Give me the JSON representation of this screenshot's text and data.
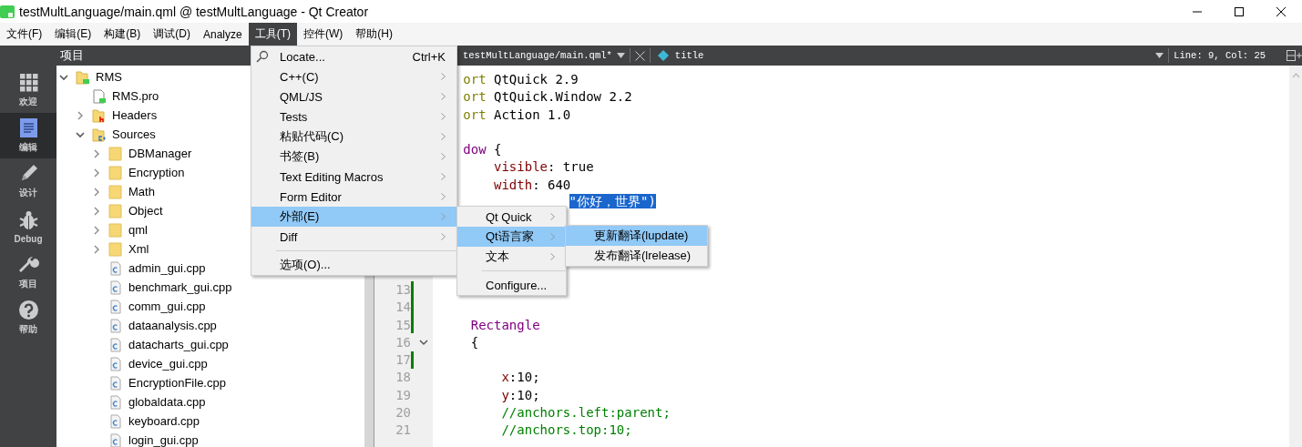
{
  "window": {
    "title": "testMultLanguage/main.qml @ testMultLanguage - Qt Creator"
  },
  "menubar": [
    {
      "label": "文件(F)",
      "selected": false
    },
    {
      "label": "编辑(E)",
      "selected": false
    },
    {
      "label": "构建(B)",
      "selected": false
    },
    {
      "label": "调试(D)",
      "selected": false
    },
    {
      "label": "Analyze",
      "selected": false
    },
    {
      "label": "工具(T)",
      "selected": true
    },
    {
      "label": "控件(W)",
      "selected": false
    },
    {
      "label": "帮助(H)",
      "selected": false
    }
  ],
  "mode_bar": [
    {
      "label": "欢迎",
      "kind": "welcome",
      "selected": false
    },
    {
      "label": "编辑",
      "kind": "edit",
      "selected": true
    },
    {
      "label": "设计",
      "kind": "design",
      "selected": false
    },
    {
      "label": "Debug",
      "kind": "debug",
      "selected": false
    },
    {
      "label": "项目",
      "kind": "projects",
      "selected": false
    },
    {
      "label": "帮助",
      "kind": "help",
      "selected": false
    }
  ],
  "project_panel": {
    "title": "项目",
    "tree": [
      {
        "label": "RMS",
        "kind": "project",
        "expanded": true,
        "children": [
          {
            "label": "RMS.pro",
            "kind": "pro-file"
          },
          {
            "label": "Headers",
            "kind": "header-folder",
            "expanded": false
          },
          {
            "label": "Sources",
            "kind": "source-folder",
            "expanded": true,
            "children": [
              {
                "label": "DBManager",
                "kind": "folder",
                "expanded": false
              },
              {
                "label": "Encryption",
                "kind": "folder",
                "expanded": false
              },
              {
                "label": "Math",
                "kind": "folder",
                "expanded": false
              },
              {
                "label": "Object",
                "kind": "folder",
                "expanded": false
              },
              {
                "label": "qml",
                "kind": "folder",
                "expanded": false
              },
              {
                "label": "Xml",
                "kind": "folder",
                "expanded": false
              },
              {
                "label": "admin_gui.cpp",
                "kind": "cpp-file"
              },
              {
                "label": "benchmark_gui.cpp",
                "kind": "cpp-file"
              },
              {
                "label": "comm_gui.cpp",
                "kind": "cpp-file"
              },
              {
                "label": "dataanalysis.cpp",
                "kind": "cpp-file"
              },
              {
                "label": "datacharts_gui.cpp",
                "kind": "cpp-file"
              },
              {
                "label": "device_gui.cpp",
                "kind": "cpp-file"
              },
              {
                "label": "EncryptionFile.cpp",
                "kind": "cpp-file"
              },
              {
                "label": "globaldata.cpp",
                "kind": "cpp-file"
              },
              {
                "label": "keyboard.cpp",
                "kind": "cpp-file"
              },
              {
                "label": "login_gui.cpp",
                "kind": "cpp-file"
              }
            ]
          }
        ]
      }
    ]
  },
  "editor": {
    "file": "testMultLanguage/main.qml*",
    "symbol": "title",
    "position": "Line: 9, Col: 25",
    "lines": [
      {
        "kind": "code",
        "tokens": [
          {
            "kind": "keyword",
            "text": "ort"
          },
          {
            "kind": "plain",
            "text": " QtQuick 2.9"
          }
        ]
      },
      {
        "kind": "code",
        "tokens": [
          {
            "kind": "keyword",
            "text": "ort"
          },
          {
            "kind": "plain",
            "text": " QtQuick.Window 2.2"
          }
        ]
      },
      {
        "kind": "code",
        "tokens": [
          {
            "kind": "keyword",
            "text": "ort"
          },
          {
            "kind": "plain",
            "text": " Action 1.0"
          }
        ]
      },
      {
        "kind": "blank"
      },
      {
        "kind": "code",
        "tokens": [
          {
            "kind": "type",
            "text": "dow"
          },
          {
            "kind": "plain",
            "text": " {"
          }
        ]
      },
      {
        "kind": "code",
        "tokens": [
          {
            "kind": "property",
            "text": "    visible"
          },
          {
            "kind": "plain",
            "text": ": true"
          }
        ]
      },
      {
        "kind": "code",
        "tokens": [
          {
            "kind": "property",
            "text": "    width"
          },
          {
            "kind": "plain",
            "text": ": 640"
          }
        ]
      },
      {
        "kind": "code",
        "tokens": [
          {
            "kind": "selection",
            "text": "\"你好，世界\")"
          }
        ]
      },
      {
        "kind": "blank",
        "number": "13",
        "changed": true
      },
      {
        "kind": "blank",
        "number": "14",
        "changed": true
      },
      {
        "kind": "code",
        "number": "15",
        "changed": true,
        "tokens": [
          {
            "kind": "type",
            "text": "    Rectangle"
          }
        ]
      },
      {
        "kind": "code",
        "number": "16",
        "changed": false,
        "expanded": true,
        "tokens": [
          {
            "kind": "plain",
            "text": "    {"
          }
        ]
      },
      {
        "kind": "blank",
        "number": "17",
        "changed": true
      },
      {
        "kind": "code",
        "number": "18",
        "changed": false,
        "tokens": [
          {
            "kind": "property",
            "text": "        x"
          },
          {
            "kind": "plain",
            "text": ":10;"
          }
        ]
      },
      {
        "kind": "code",
        "number": "19",
        "changed": false,
        "tokens": [
          {
            "kind": "property",
            "text": "        y"
          },
          {
            "kind": "plain",
            "text": ":10;"
          }
        ]
      },
      {
        "kind": "code",
        "number": "20",
        "changed": false,
        "tokens": [
          {
            "kind": "comment",
            "text": "        //anchors.left:parent;"
          }
        ]
      },
      {
        "kind": "code",
        "number": "21",
        "changed": false,
        "tokens": [
          {
            "kind": "comment",
            "text": "        //anchors.top:10;"
          }
        ]
      }
    ]
  },
  "tools_menu": {
    "items": [
      {
        "kind": "search",
        "label": "Locate...",
        "shortcut": "Ctrl+K",
        "selected": false
      },
      {
        "kind": "submenu",
        "label": "C++(C)",
        "selected": false
      },
      {
        "kind": "submenu",
        "label": "QML/JS",
        "selected": false
      },
      {
        "kind": "submenu",
        "label": "Tests",
        "selected": false
      },
      {
        "kind": "submenu",
        "label": "粘贴代码(C)",
        "selected": false
      },
      {
        "kind": "submenu",
        "label": "书签(B)",
        "selected": false
      },
      {
        "kind": "submenu",
        "label": "Text Editing Macros",
        "selected": false
      },
      {
        "kind": "submenu",
        "label": "Form Editor",
        "selected": false
      },
      {
        "kind": "submenu",
        "label": "外部(E)",
        "selected": true
      },
      {
        "kind": "submenu",
        "label": "Diff",
        "selected": false
      },
      {
        "kind": "separator"
      },
      {
        "kind": "action",
        "label": "选项(O)...",
        "selected": false
      }
    ]
  },
  "external_submenu": {
    "items": [
      {
        "kind": "submenu",
        "label": "Qt Quick",
        "selected": false
      },
      {
        "kind": "submenu",
        "label": "Qt语言家",
        "selected": true
      },
      {
        "kind": "submenu",
        "label": "文本",
        "selected": false
      },
      {
        "kind": "separator"
      },
      {
        "kind": "action",
        "label": "Configure...",
        "selected": false
      }
    ]
  },
  "linguist_submenu": {
    "items": [
      {
        "label": "更新翻译(lupdate)",
        "selected": true
      },
      {
        "label": "发布翻译(lrelease)",
        "selected": false
      }
    ]
  }
}
